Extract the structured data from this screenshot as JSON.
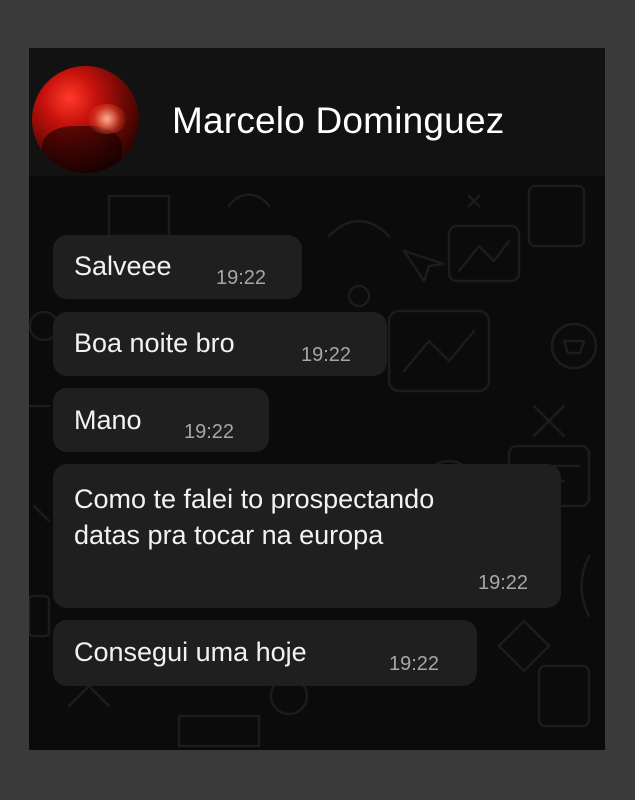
{
  "header": {
    "contact_name": "Marcelo Dominguez",
    "avatar_icon": "contact-avatar-photo"
  },
  "messages": [
    {
      "text": "Salveee",
      "time": "19:22"
    },
    {
      "text": "Boa noite bro",
      "time": "19:22"
    },
    {
      "text": "Mano",
      "time": "19:22"
    },
    {
      "text_line1": "Como te falei to prospectando",
      "text_line2": "datas pra tocar na europa",
      "time": "19:22"
    },
    {
      "text": "Consegui uma hoje",
      "time": "19:22"
    }
  ],
  "colors": {
    "background": "#3a3a3a",
    "chat_background": "#0b0b0b",
    "bubble": "#1f1f1f",
    "text": "#f2f2f2",
    "time": "#a6a6a6"
  }
}
